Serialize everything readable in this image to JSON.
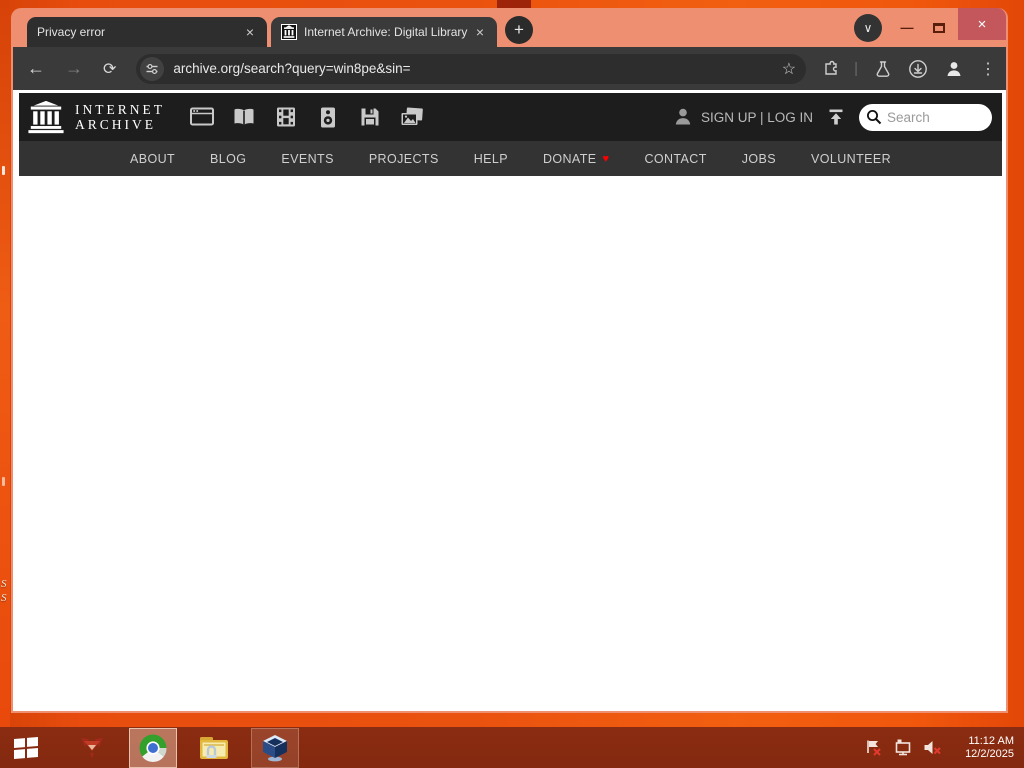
{
  "desktop": {
    "icon_label_fragments": [
      "S",
      "S"
    ]
  },
  "browser": {
    "tabs": [
      {
        "title": "Privacy error"
      },
      {
        "title": "Internet Archive: Digital Library"
      }
    ],
    "toolbar": {
      "url": "archive.org/search?query=win8pe&sin="
    }
  },
  "glyphs": {
    "close_tab": "×",
    "new_tab": "+",
    "tab_search": "∨",
    "minimize": "—",
    "window_close": "×",
    "back": "←",
    "forward": "→",
    "reload": "⟳",
    "bookmark_star": "☆",
    "toolbar_divider": "|",
    "menu_kebab": "⋮",
    "donate_heart": "♥"
  },
  "ia": {
    "logo": {
      "line1": "INTERNET",
      "line2": "ARCHIVE"
    },
    "media_icons": [
      "web",
      "texts",
      "video",
      "audio",
      "software",
      "images"
    ],
    "account_text": "SIGN UP | LOG IN",
    "search_placeholder": "Search",
    "nav": {
      "about": "ABOUT",
      "blog": "BLOG",
      "events": "EVENTS",
      "projects": "PROJECTS",
      "help": "HELP",
      "donate": "DONATE",
      "contact": "CONTACT",
      "jobs": "JOBS",
      "volunteer": "VOLUNTEER"
    }
  },
  "taskbar": {
    "clock": {
      "time": "11:12 AM",
      "date": "12/2/2025"
    }
  },
  "colors": {
    "window_frame": "#ed8f70",
    "toolbar_bg": "#3a3a3a",
    "tab_inactive_bg": "#2e2e2e",
    "close_button_bg": "#c4575c",
    "ia_header_bg": "#1d1d1d",
    "ia_nav_bg": "#333333",
    "donate_heart": "#ff0000",
    "taskbar_bg": "#872a10",
    "desktop_base": "#ea520f"
  }
}
